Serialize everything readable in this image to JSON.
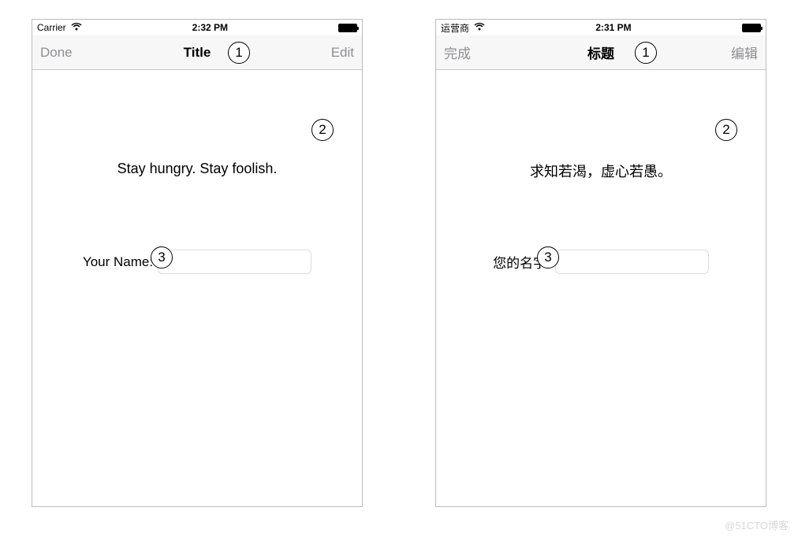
{
  "left_phone": {
    "status": {
      "carrier": "Carrier",
      "time": "2:32 PM"
    },
    "nav": {
      "left": "Done",
      "title": "Title",
      "right": "Edit"
    },
    "quote": "Stay hungry. Stay foolish.",
    "name_label": "Your Name:",
    "name_value": "",
    "annotations": {
      "one": "1",
      "two": "2",
      "three": "3"
    }
  },
  "right_phone": {
    "status": {
      "carrier": "运营商",
      "time": "2:31 PM"
    },
    "nav": {
      "left": "完成",
      "title": "标题",
      "right": "编辑"
    },
    "quote": "求知若渴，虚心若愚。",
    "name_label": "您的名字:",
    "name_value": "",
    "annotations": {
      "one": "1",
      "two": "2",
      "three": "3"
    }
  },
  "watermark": "@51CTO博客"
}
